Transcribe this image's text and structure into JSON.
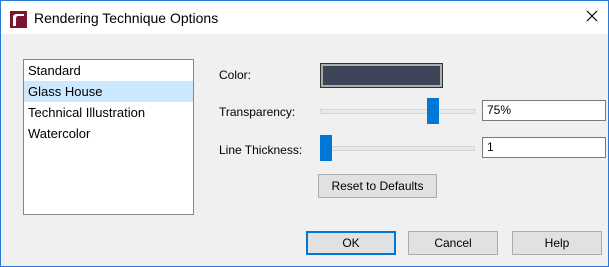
{
  "window": {
    "title": "Rendering Technique Options",
    "icon": "app-logo-icon",
    "close_icon": "close-icon"
  },
  "techniques": {
    "items": [
      "Standard",
      "Glass House",
      "Technical Illustration",
      "Watercolor"
    ],
    "selected": "Glass House"
  },
  "color": {
    "label": "Color:",
    "value": "#3c4658"
  },
  "transparency": {
    "label": "Transparency:",
    "value": "75%",
    "level": 0.75
  },
  "line_thickness": {
    "label": "Line Thickness:",
    "value": "1",
    "level": 0
  },
  "buttons": {
    "reset": "Reset to Defaults",
    "ok": "OK",
    "cancel": "Cancel",
    "help": "Help"
  },
  "colors": {
    "accent": "#0078d7",
    "selection": "#cce8ff",
    "window_border": "#2b79d7"
  }
}
